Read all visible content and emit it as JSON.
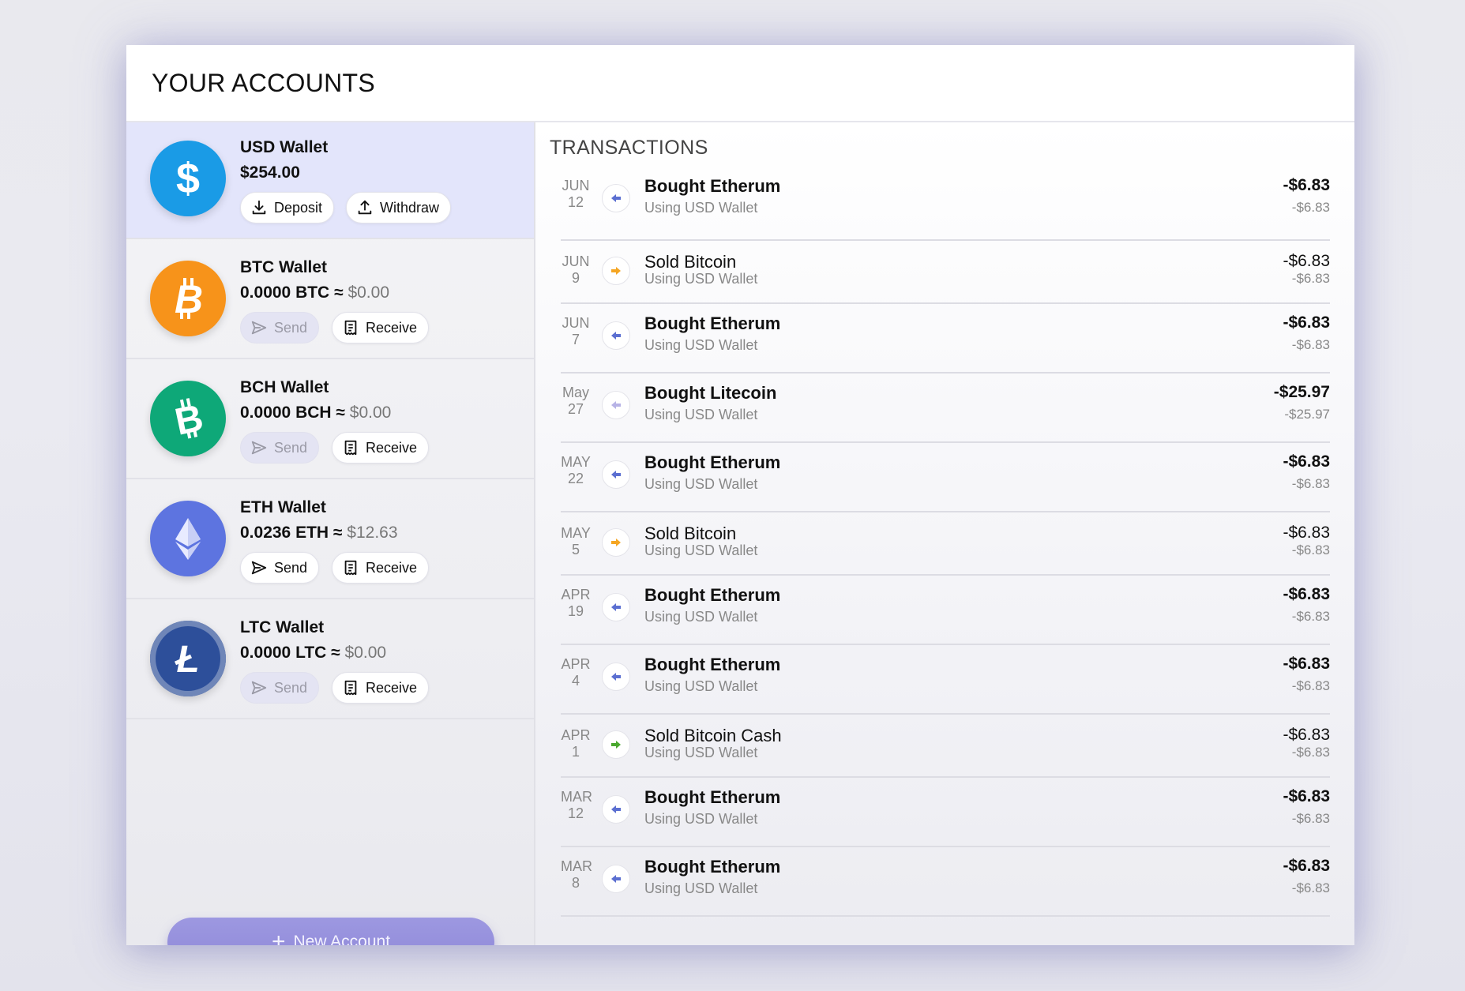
{
  "header": {
    "title": "YOUR ACCOUNTS"
  },
  "wallets": [
    {
      "name": "USD Wallet",
      "amount": "$254.00",
      "approx": "",
      "fiat": "",
      "coin_icon": "dollar-icon",
      "coin_color": "#1a9be6",
      "buttons": [
        {
          "label": "Deposit",
          "icon": "download-icon",
          "disabled": false
        },
        {
          "label": "Withdraw",
          "icon": "upload-icon",
          "disabled": false
        }
      ]
    },
    {
      "name": "BTC Wallet",
      "amount": "0.0000 BTC",
      "approx": "≈",
      "fiat": "$0.00",
      "coin_icon": "bitcoin-icon",
      "coin_color": "#f7931a",
      "buttons": [
        {
          "label": "Send",
          "icon": "send-icon",
          "disabled": true
        },
        {
          "label": "Receive",
          "icon": "receipt-icon",
          "disabled": false
        }
      ]
    },
    {
      "name": "BCH Wallet",
      "amount": "0.0000 BCH",
      "approx": "≈",
      "fiat": "$0.00",
      "coin_icon": "bitcoin-cash-icon",
      "coin_color": "#0ea878",
      "buttons": [
        {
          "label": "Send",
          "icon": "send-icon",
          "disabled": true
        },
        {
          "label": "Receive",
          "icon": "receipt-icon",
          "disabled": false
        }
      ]
    },
    {
      "name": "ETH Wallet",
      "amount": "0.0236 ETH",
      "approx": "≈",
      "fiat": "$12.63",
      "coin_icon": "ethereum-icon",
      "coin_color": "#5d74e0",
      "buttons": [
        {
          "label": "Send",
          "icon": "send-icon",
          "disabled": false
        },
        {
          "label": "Receive",
          "icon": "receipt-icon",
          "disabled": false
        }
      ]
    },
    {
      "name": "LTC Wallet",
      "amount": "0.0000 LTC",
      "approx": "≈",
      "fiat": "$0.00",
      "coin_icon": "litecoin-icon",
      "coin_color": "#2d4f9a",
      "buttons": [
        {
          "label": "Send",
          "icon": "send-icon",
          "disabled": true
        },
        {
          "label": "Receive",
          "icon": "receipt-icon",
          "disabled": false
        }
      ]
    }
  ],
  "new_account": {
    "label": "New Account"
  },
  "transactions": {
    "title": "TRANSACTIONS",
    "items": [
      {
        "month": "JUN",
        "day": "12",
        "name": "Bought Etherum",
        "sub": "Using USD Wallet",
        "amount": "-$6.83",
        "sub_amount": "-$6.83",
        "direction": "in",
        "color": "#5b6fd1"
      },
      {
        "month": "JUN",
        "day": "9",
        "name": "Sold Bitcoin",
        "sub": "Using USD Wallet",
        "amount": "-$6.83",
        "sub_amount": "-$6.83",
        "direction": "out",
        "color": "#f5a623"
      },
      {
        "month": "JUN",
        "day": "7",
        "name": "Bought Etherum",
        "sub": "Using USD Wallet",
        "amount": "-$6.83",
        "sub_amount": "-$6.83",
        "direction": "in",
        "color": "#5b6fd1"
      },
      {
        "month": "May",
        "day": "27",
        "name": "Bought Litecoin",
        "sub": "Using USD Wallet",
        "amount": "-$25.97",
        "sub_amount": "-$25.97",
        "direction": "in",
        "color": "#b7b3e6"
      },
      {
        "month": "MAY",
        "day": "22",
        "name": "Bought Etherum",
        "sub": "Using USD Wallet",
        "amount": "-$6.83",
        "sub_amount": "-$6.83",
        "direction": "in",
        "color": "#5b6fd1"
      },
      {
        "month": "MAY",
        "day": "5",
        "name": "Sold Bitcoin",
        "sub": "Using USD Wallet",
        "amount": "-$6.83",
        "sub_amount": "-$6.83",
        "direction": "out",
        "color": "#f5a623"
      },
      {
        "month": "APR",
        "day": "19",
        "name": "Bought Etherum",
        "sub": "Using USD Wallet",
        "amount": "-$6.83",
        "sub_amount": "-$6.83",
        "direction": "in",
        "color": "#5b6fd1"
      },
      {
        "month": "APR",
        "day": "4",
        "name": "Bought Etherum",
        "sub": "Using USD Wallet",
        "amount": "-$6.83",
        "sub_amount": "-$6.83",
        "direction": "in",
        "color": "#5b6fd1"
      },
      {
        "month": "APR",
        "day": "1",
        "name": "Sold Bitcoin Cash",
        "sub": "Using USD Wallet",
        "amount": "-$6.83",
        "sub_amount": "-$6.83",
        "direction": "out",
        "color": "#4aa82e"
      },
      {
        "month": "MAR",
        "day": "12",
        "name": "Bought Etherum",
        "sub": "Using USD Wallet",
        "amount": "-$6.83",
        "sub_amount": "-$6.83",
        "direction": "in",
        "color": "#5b6fd1"
      },
      {
        "month": "MAR",
        "day": "8",
        "name": "Bought Etherum",
        "sub": "Using USD Wallet",
        "amount": "-$6.83",
        "sub_amount": "-$6.83",
        "direction": "in",
        "color": "#5b6fd1"
      }
    ]
  }
}
